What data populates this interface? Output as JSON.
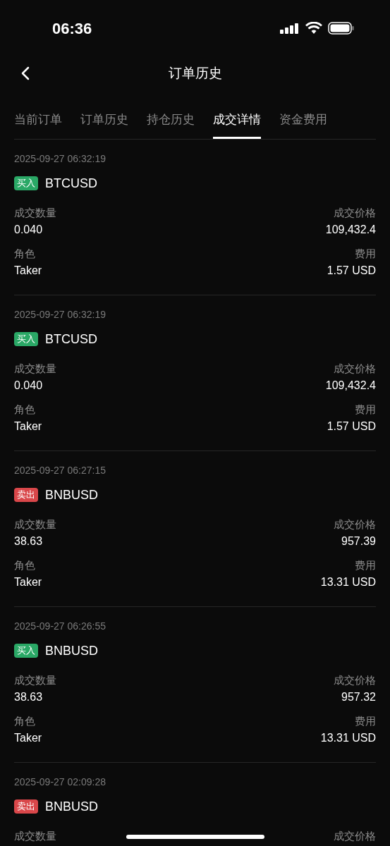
{
  "status_bar": {
    "time": "06:36"
  },
  "header": {
    "title": "订单历史"
  },
  "tabs": [
    {
      "label": "当前订单",
      "selected": false
    },
    {
      "label": "订单历史",
      "selected": false
    },
    {
      "label": "持仓历史",
      "selected": false
    },
    {
      "label": "成交详情",
      "selected": true
    },
    {
      "label": "资金费用",
      "selected": false
    }
  ],
  "trades": [
    {
      "time": "2025-09-27 06:32:19",
      "kind": "buy",
      "side_label": "买入",
      "symbol": "BTCUSD",
      "fields": [
        {
          "label": "成交数量",
          "value": "0.040"
        },
        {
          "label": "成交价格",
          "value": "109,432.4"
        },
        {
          "label": "角色",
          "value": "Taker"
        },
        {
          "label": "费用",
          "value": "1.57 USD"
        }
      ]
    },
    {
      "time": "2025-09-27 06:32:19",
      "kind": "buy",
      "side_label": "买入",
      "symbol": "BTCUSD",
      "fields": [
        {
          "label": "成交数量",
          "value": "0.040"
        },
        {
          "label": "成交价格",
          "value": "109,432.4"
        },
        {
          "label": "角色",
          "value": "Taker"
        },
        {
          "label": "费用",
          "value": "1.57 USD"
        }
      ]
    },
    {
      "time": "2025-09-27 06:27:15",
      "kind": "sell",
      "side_label": "卖出",
      "symbol": "BNBUSD",
      "fields": [
        {
          "label": "成交数量",
          "value": "38.63"
        },
        {
          "label": "成交价格",
          "value": "957.39"
        },
        {
          "label": "角色",
          "value": "Taker"
        },
        {
          "label": "费用",
          "value": "13.31 USD"
        }
      ]
    },
    {
      "time": "2025-09-27 06:26:55",
      "kind": "buy",
      "side_label": "买入",
      "symbol": "BNBUSD",
      "fields": [
        {
          "label": "成交数量",
          "value": "38.63"
        },
        {
          "label": "成交价格",
          "value": "957.32"
        },
        {
          "label": "角色",
          "value": "Taker"
        },
        {
          "label": "费用",
          "value": "13.31 USD"
        }
      ]
    },
    {
      "time": "2025-09-27 02:09:28",
      "kind": "sell",
      "side_label": "卖出",
      "symbol": "BNBUSD",
      "fields": [
        {
          "label": "成交数量"
        },
        {
          "label": "成交价格"
        }
      ]
    }
  ]
}
